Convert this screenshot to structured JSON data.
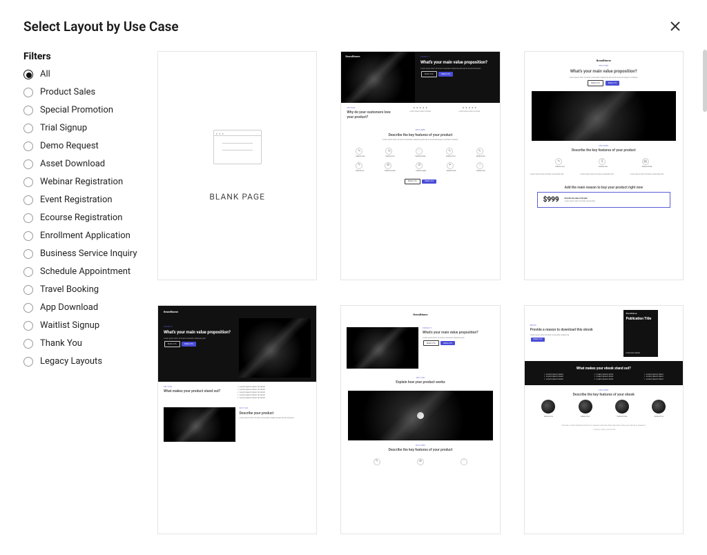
{
  "title": "Select Layout by Use Case",
  "filters_heading": "Filters",
  "filters": [
    {
      "label": "All",
      "selected": true
    },
    {
      "label": "Product Sales",
      "selected": false
    },
    {
      "label": "Special Promotion",
      "selected": false
    },
    {
      "label": "Trial Signup",
      "selected": false
    },
    {
      "label": "Demo Request",
      "selected": false
    },
    {
      "label": "Asset Download",
      "selected": false
    },
    {
      "label": "Webinar Registration",
      "selected": false
    },
    {
      "label": "Event Registration",
      "selected": false
    },
    {
      "label": "Ecourse Registration",
      "selected": false
    },
    {
      "label": "Enrollment Application",
      "selected": false
    },
    {
      "label": "Business Service Inquiry",
      "selected": false
    },
    {
      "label": "Schedule Appointment",
      "selected": false
    },
    {
      "label": "Travel Booking",
      "selected": false
    },
    {
      "label": "App Download",
      "selected": false
    },
    {
      "label": "Waitlist Signup",
      "selected": false
    },
    {
      "label": "Thank You",
      "selected": false
    },
    {
      "label": "Legacy Layouts",
      "selected": false
    }
  ],
  "cards": {
    "blank": {
      "label": "BLANK PAGE"
    },
    "c1": {
      "brand": "BrandName",
      "eyebrow": "PRODUCT",
      "hero_h": "What's your main value proposition?",
      "cta1": "Button CTA",
      "cta2": "Button CTA",
      "sec1_eyebrow": "SECTION",
      "sec1_h": "Why do your customers love your product?",
      "features_h": "Describe the key features of your product",
      "feat_labels": [
        "Feature one",
        "Feature two",
        "Feature three",
        "Feature four",
        "Feature five",
        "Feature six",
        "Feature seven",
        "Feature eight",
        "Feature nine",
        "Feature ten"
      ]
    },
    "c2": {
      "brand": "BrandName",
      "hero_h": "What's your main value proposition?",
      "cta1": "Button CTA",
      "cta2": "Button CTA",
      "features_eyebrow": "FEATURES",
      "features_h": "Describe the key features of your product",
      "feat_labels": [
        "Feature one",
        "Feature two",
        "Feature three"
      ],
      "promo_h": "Add the main reason to buy your product right now",
      "price": "$999"
    },
    "c3": {
      "brand": "BrandName",
      "hero_h": "What's your main value proposition?",
      "cta1": "Button CTA",
      "cta2": "Button CTA",
      "standout_h": "What makes your product stand out?",
      "describe_h": "Describe your product"
    },
    "c4": {
      "brand": "BrandName",
      "hero_h": "What's your main value proposition?",
      "cta1": "Button CTA",
      "cta2": "Button CTA",
      "how_eyebrow": "SECTION",
      "how_h": "Explain how your product works",
      "features_eyebrow": "FEATURES",
      "features_h": "Describe the key features of your product"
    },
    "c5": {
      "brand": "BrandName",
      "hero_h": "Provide a reason to download this ebook",
      "cta1": "Button CTA",
      "book_title": "Publication Title",
      "book_sub": "Publication details",
      "standout_h": "What makes your ebook stand out?",
      "features_eyebrow": "FEATURES",
      "features_h": "Describe the key features of your ebook",
      "feat_labels": [
        "Feature one",
        "Feature two",
        "Feature three",
        "Feature four"
      ],
      "testimonial": "\"Provide a short testimonial from a valued customer that describes why your ebook is superior.\"",
      "testi_name": "— Customer name, role and title"
    }
  }
}
